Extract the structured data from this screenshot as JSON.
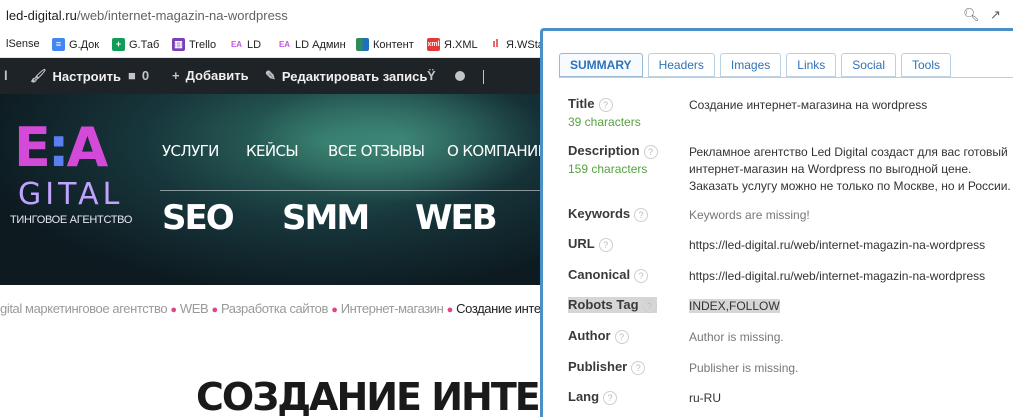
{
  "address_bar": {
    "domain": "led-digital.ru",
    "path": "/web/internet-magazin-na-wordpress"
  },
  "bookmarks": [
    {
      "label": "lSense",
      "icon": "none"
    },
    {
      "label": "G.Док",
      "icon": "google-docs-icon",
      "color": "#4285f4"
    },
    {
      "label": "G.Таб",
      "icon": "google-sheets-icon",
      "color": "#0f9d58"
    },
    {
      "label": "Trello",
      "icon": "trello-icon",
      "color": "#7b3fb8"
    },
    {
      "label": "LD",
      "icon": "ld-icon",
      "color": "#c356e0"
    },
    {
      "label": "LD Админ",
      "icon": "ld-icon",
      "color": "#c356e0"
    },
    {
      "label": "Контент",
      "icon": "content-icon",
      "color": "#2e8b57"
    },
    {
      "label": "Я.XML",
      "icon": "yandex-xml-icon",
      "color": "#e53935"
    },
    {
      "label": "Я.WStat",
      "icon": "yandex-wordstat-icon",
      "color": "#e53935"
    }
  ],
  "wp_bar": {
    "customize": "Настроить",
    "comments_count": "0",
    "add_new": "Добавить",
    "edit_post": "Редактировать запись"
  },
  "hero": {
    "logo_subtitle": "ТИНГОВОЕ АГЕНТСТВО",
    "logo_tail": "GITAL",
    "nav": [
      "УСЛУГИ",
      "КЕЙСЫ",
      "ВСЕ ОТЗЫВЫ",
      "О КОМПАНИИ"
    ],
    "services": [
      "SEO",
      "SMM",
      "WEB"
    ]
  },
  "breadcrumb": {
    "items": [
      "gital маркетинговое агентство",
      "WEB",
      "Разработка сайтов",
      "Интернет-магазин"
    ],
    "current": "Создание интернет"
  },
  "page_heading": "СОЗДАНИЕ ИНТЕРНЕТ-МА",
  "seo_panel": {
    "tabs": [
      "SUMMARY",
      "Headers",
      "Images",
      "Links",
      "Social",
      "Tools"
    ],
    "rows": {
      "title": {
        "label": "Title",
        "count": "39 characters",
        "value": "Создание интернет-магазина на wordpress"
      },
      "description": {
        "label": "Description",
        "count": "159 characters",
        "value": "Рекламное агентство Led Digital создаст для вас готовый интернет-магазин на Wordpress по выгодной цене. Заказать услугу можно не только по Москве, но и России."
      },
      "keywords": {
        "label": "Keywords",
        "value": "Keywords are missing!"
      },
      "url": {
        "label": "URL",
        "value": "https://led-digital.ru/web/internet-magazin-na-wordpress"
      },
      "canonical": {
        "label": "Canonical",
        "value": "https://led-digital.ru/web/internet-magazin-na-wordpress"
      },
      "robots": {
        "label": "Robots Tag",
        "value": "INDEX,FOLLOW"
      },
      "author": {
        "label": "Author",
        "value": "Author is missing."
      },
      "publisher": {
        "label": "Publisher",
        "value": "Publisher is missing."
      },
      "lang": {
        "label": "Lang",
        "value": "ru-RU"
      }
    },
    "help_glyph": "?"
  }
}
